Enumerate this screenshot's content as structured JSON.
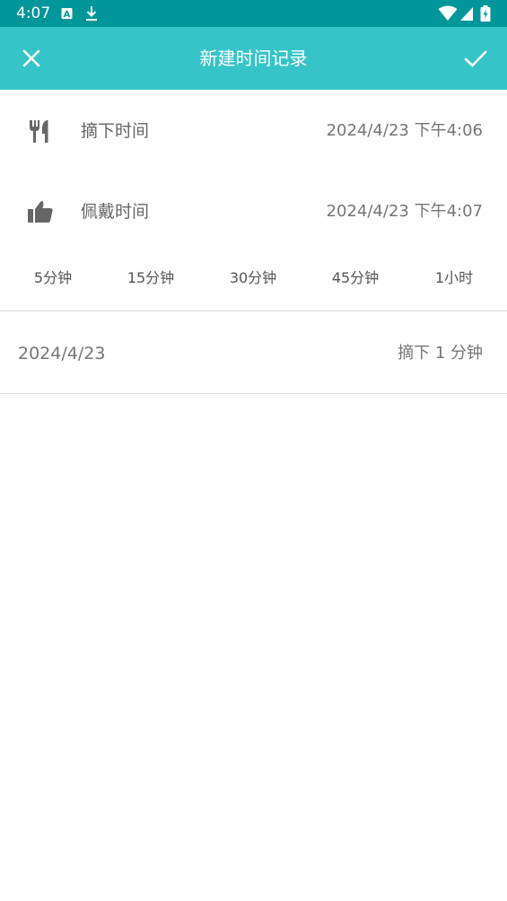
{
  "status_bar": {
    "time": "4:07",
    "notification_icons": [
      "accessibility-a-icon",
      "download-icon"
    ],
    "system_icons": [
      "wifi-icon",
      "signal-icon",
      "battery-charging-icon"
    ]
  },
  "app_bar": {
    "title": "新建时间记录",
    "close_icon": "close-icon",
    "confirm_icon": "check-icon",
    "color": "#36c4c8",
    "status_color": "#00969a"
  },
  "remove_time": {
    "icon": "fork-knife-icon",
    "label": "摘下时间",
    "value": "2024/4/23 下午4:06"
  },
  "wear_time": {
    "icon": "thumbs-up-icon",
    "label": "佩戴时间",
    "value": "2024/4/23 下午4:07"
  },
  "quick_durations": [
    "5分钟",
    "15分钟",
    "30分钟",
    "45分钟",
    "1小时"
  ],
  "summary": {
    "date": "2024/4/23",
    "duration": "摘下 1 分钟"
  }
}
